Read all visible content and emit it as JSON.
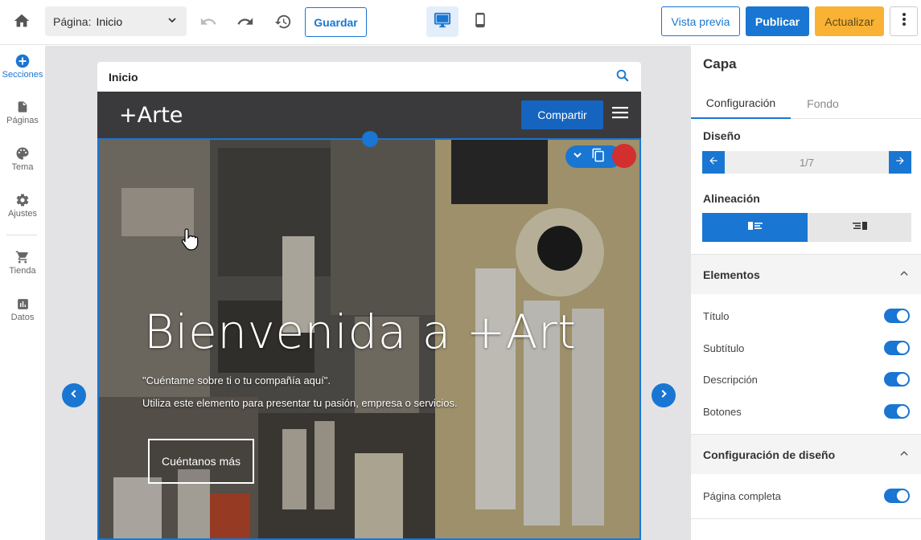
{
  "topbar": {
    "page_label": "Página:",
    "page_value": "Inicio",
    "save": "Guardar",
    "preview": "Vista previa",
    "publish": "Publicar",
    "update": "Actualizar"
  },
  "leftnav": {
    "items": [
      {
        "label": "Secciones",
        "icon": "add-circle-icon"
      },
      {
        "label": "Páginas",
        "icon": "file-icon"
      },
      {
        "label": "Tema",
        "icon": "palette-icon"
      },
      {
        "label": "Ajustes",
        "icon": "gear-icon"
      },
      {
        "label": "Tienda",
        "icon": "cart-icon"
      },
      {
        "label": "Datos",
        "icon": "bar-chart-icon"
      }
    ]
  },
  "canvas": {
    "page_name": "Inicio",
    "site": {
      "logo": "+Arte",
      "share": "Compartir",
      "hero_title": "Bienvenida a +Art",
      "hero_subtitle": "\"Cuéntame sobre ti o tu compañía aquí\".",
      "hero_description": "Utiliza este elemento para presentar tu pasión, empresa o servicios.",
      "hero_button": "Cuéntanos más"
    }
  },
  "panel": {
    "title": "Capa",
    "tabs": [
      "Configuración",
      "Fondo"
    ],
    "design_label": "Diseño",
    "design_value": "1/7",
    "alignment_label": "Alineación",
    "elements_label": "Elementos",
    "elements": [
      {
        "label": "Título",
        "on": true
      },
      {
        "label": "Subtítulo",
        "on": true
      },
      {
        "label": "Descripción",
        "on": true
      },
      {
        "label": "Botones",
        "on": true
      }
    ],
    "layout_label": "Configuración de diseño",
    "layout_items": [
      {
        "label": "Página completa",
        "on": true
      }
    ]
  },
  "colors": {
    "accent": "#1976d2",
    "update": "#f9b234",
    "delete": "#d32f2f"
  }
}
